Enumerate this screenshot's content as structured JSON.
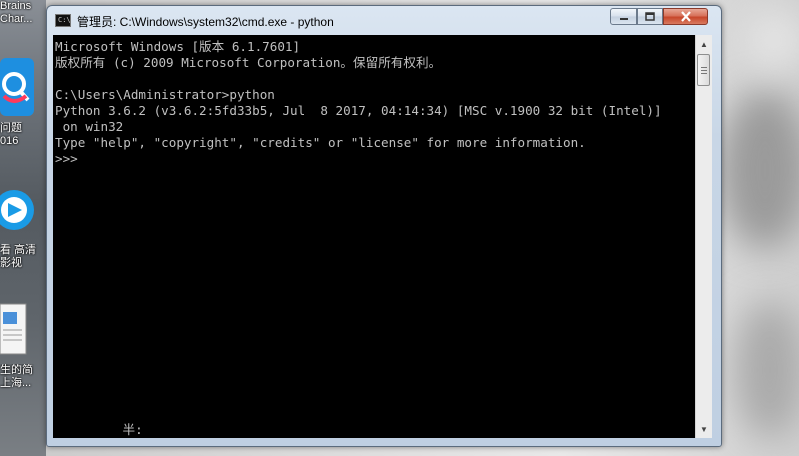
{
  "desktop": {
    "icons": [
      {
        "name": "jetbrains",
        "label_lines": [
          "Brains",
          "Char..."
        ]
      },
      {
        "name": "baidu-zhidao",
        "label_lines": [
          "问题",
          "016"
        ]
      },
      {
        "name": "video-player",
        "label_lines": [
          "看 高清",
          "影视"
        ]
      },
      {
        "name": "document",
        "label_lines": [
          "生的简",
          "上海..."
        ]
      }
    ]
  },
  "window": {
    "title": "管理员: C:\\Windows\\system32\\cmd.exe - python",
    "icon_text": "C:\\"
  },
  "console": {
    "lines": [
      "Microsoft Windows [版本 6.1.7601]",
      "版权所有 (c) 2009 Microsoft Corporation。保留所有权利。",
      "",
      "C:\\Users\\Administrator>python",
      "Python 3.6.2 (v3.6.2:5fd33b5, Jul  8 2017, 04:14:34) [MSC v.1900 32 bit (Intel)]",
      " on win32",
      "Type \"help\", \"copyright\", \"credits\" or \"license\" for more information.",
      ">>>"
    ],
    "ime_status": "      半:"
  },
  "colors": {
    "console_bg": "#000000",
    "console_fg": "#c0c0c0",
    "close_button": "#c7472b"
  }
}
